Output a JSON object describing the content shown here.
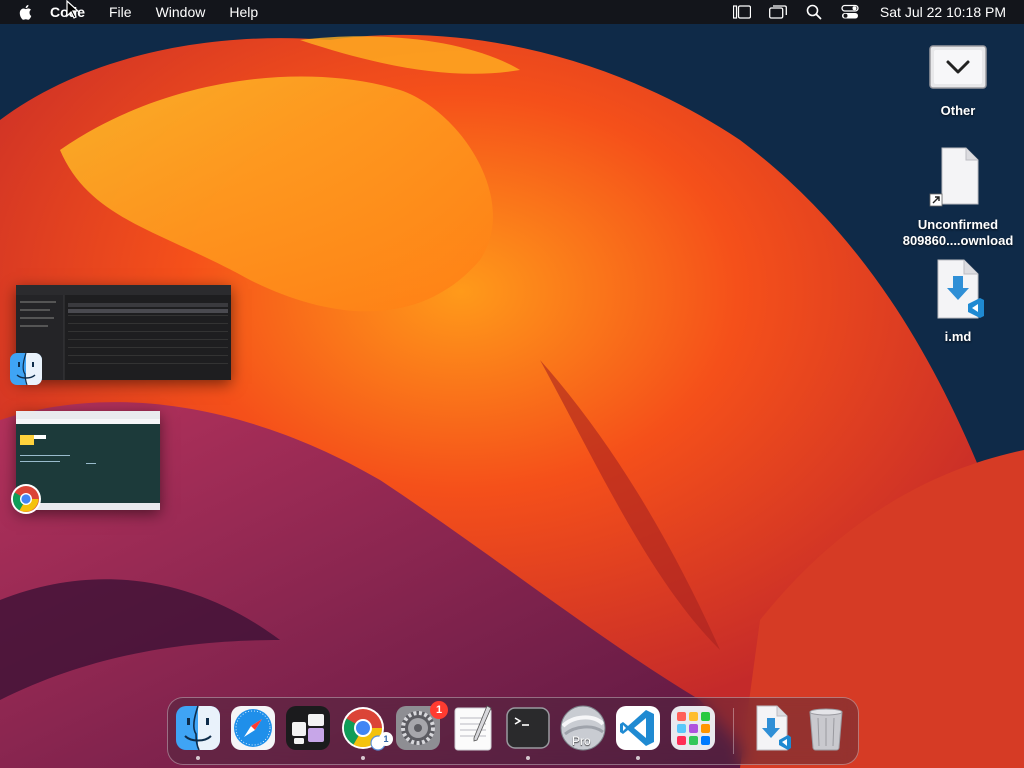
{
  "menubar": {
    "app_name": "Code",
    "menus": [
      "File",
      "Window",
      "Help"
    ],
    "status_icons": [
      "stage-manager-icon",
      "screen-mirroring-icon",
      "spotlight-search-icon",
      "control-center-icon"
    ],
    "clock": "Sat Jul 22  10:18 PM"
  },
  "desktop_icons": [
    {
      "label": "Other",
      "icon": "stack-folder-icon"
    },
    {
      "label": "Unconfirmed 809860....ownload",
      "icon": "document-alias-icon"
    },
    {
      "label": "i.md",
      "icon": "vscode-markdown-file-icon"
    }
  ],
  "minimized_windows": [
    {
      "app": "Finder",
      "icon": "finder-icon"
    },
    {
      "app": "Google Chrome",
      "icon": "chrome-icon"
    }
  ],
  "dock": {
    "apps": [
      {
        "name": "Finder",
        "icon": "finder-icon",
        "running": true
      },
      {
        "name": "Safari",
        "icon": "safari-icon",
        "running": false
      },
      {
        "name": "Stage Manager",
        "icon": "app-grid-icon",
        "running": false
      },
      {
        "name": "Google Chrome",
        "icon": "chrome-icon",
        "running": true,
        "badge": "1"
      },
      {
        "name": "System Settings",
        "icon": "settings-gear-icon",
        "running": false,
        "badge": "1"
      },
      {
        "name": "TextEdit",
        "icon": "textedit-icon",
        "running": false
      },
      {
        "name": "Terminal",
        "icon": "terminal-icon",
        "running": true
      },
      {
        "name": "Google Earth Pro",
        "icon": "earth-pro-icon",
        "running": false,
        "caption": "Pro"
      },
      {
        "name": "Visual Studio Code",
        "icon": "vscode-icon",
        "running": true
      },
      {
        "name": "Launchpad",
        "icon": "launchpad-icon",
        "running": false
      }
    ],
    "others": [
      {
        "name": "Downloads",
        "icon": "download-file-icon"
      },
      {
        "name": "Trash",
        "icon": "trash-icon"
      }
    ]
  },
  "colors": {
    "menubar_bg": "#141418",
    "badge": "#ff3b30",
    "vscode_blue": "#1f8ad2"
  }
}
